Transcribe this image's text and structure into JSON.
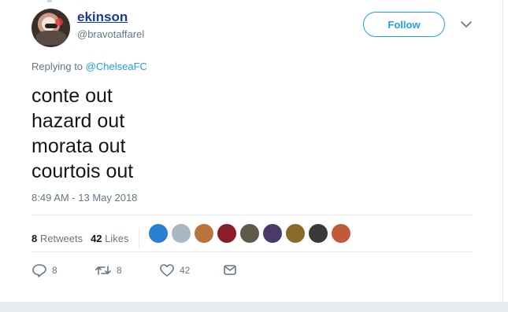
{
  "user": {
    "name": "ekinson",
    "handle": "@bravotaffarel"
  },
  "follow_label": "Follow",
  "replying": {
    "prefix": "Replying to",
    "mention": "@ChelseaFC"
  },
  "tweet_lines": [
    "conte out",
    "hazard out",
    "morata out",
    "courtois out"
  ],
  "timestamp": "8:49 AM - 13 May 2018",
  "stats": {
    "retweets_count": "8",
    "retweets_label": "Retweets",
    "likes_count": "42",
    "likes_label": "Likes"
  },
  "liker_colors": [
    "#2b7fd1",
    "#aab8c2",
    "#b8743d",
    "#8a1d2a",
    "#5f5a4a",
    "#4a3a6a",
    "#8a6a2a",
    "#3a3a3a",
    "#c05a3a"
  ],
  "actions": {
    "reply_count": "8",
    "retweet_count": "8",
    "like_count": "42"
  },
  "colors": {
    "accent": "#1da1f2",
    "text": "#14171a",
    "muted": "#657786",
    "name": "#1b3a92"
  }
}
